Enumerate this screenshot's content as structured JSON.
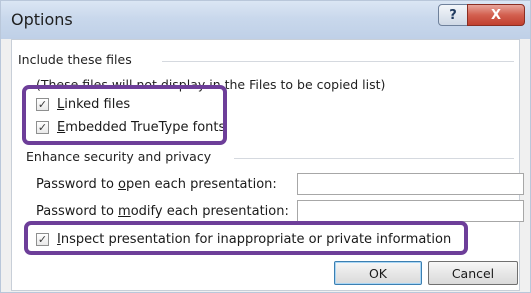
{
  "window": {
    "title": "Options",
    "help_glyph": "?",
    "close_glyph": "X"
  },
  "include_files": {
    "heading": "Include these files",
    "note": "(These files will not display in the Files to be copied list)",
    "linked_files": {
      "accel": "L",
      "rest": "inked files",
      "checked": true
    },
    "embedded_fonts": {
      "accel": "E",
      "rest": "mbedded TrueType fonts",
      "checked": true
    }
  },
  "security": {
    "heading": "Enhance security and privacy",
    "password_open": {
      "pre": "Password to ",
      "accel": "o",
      "post": "pen each presentation:",
      "value": ""
    },
    "password_modify": {
      "pre": "Password to ",
      "accel": "m",
      "post": "odify each presentation:",
      "value": ""
    },
    "inspect": {
      "accel": "I",
      "rest": "nspect presentation for inappropriate or private information",
      "checked": true
    }
  },
  "buttons": {
    "ok": "OK",
    "cancel": "Cancel"
  },
  "colors": {
    "highlight": "#6d3e99",
    "close_button": "#c1402f",
    "titlebar": "#c9d8ec"
  },
  "checkmark": "✓"
}
